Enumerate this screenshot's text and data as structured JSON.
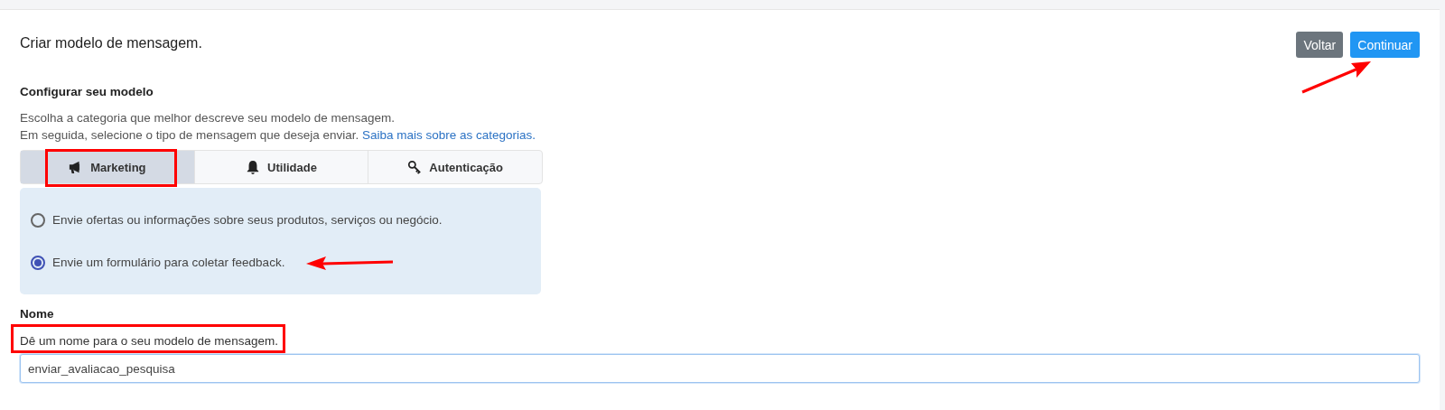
{
  "header": {
    "title": "Criar modelo de mensagem."
  },
  "buttons": [
    {
      "kind": "secondary",
      "label": "Voltar",
      "arrow": false
    },
    {
      "kind": "primary",
      "label": "Continuar",
      "arrow": true
    }
  ],
  "section": {
    "title": "Configurar seu modelo",
    "description_lines": [
      "Escolha a categoria que melhor descreve seu modelo de mensagem.",
      "Em seguida, selecione o tipo de mensagem que deseja enviar."
    ],
    "link": "Saiba mais sobre as categorias."
  },
  "tabs": [
    {
      "label": "Marketing",
      "selected": true,
      "highlighted": true
    },
    {
      "label": "Utilidade",
      "selected": false,
      "highlighted": false
    },
    {
      "label": "Autenticação",
      "selected": false,
      "highlighted": false
    }
  ],
  "options": [
    {
      "label": "Envie ofertas ou informações sobre seus produtos, serviços ou negócio.",
      "selected": false,
      "arrow": false
    },
    {
      "label": "Envie um formulário para coletar feedback.",
      "selected": true,
      "arrow": true
    }
  ],
  "name_field": {
    "label": "Nome",
    "hint": "Dê um nome para o seu modelo de mensagem.",
    "hint_highlighted": true,
    "value": "enviar_avaliacao_pesquisa"
  }
}
